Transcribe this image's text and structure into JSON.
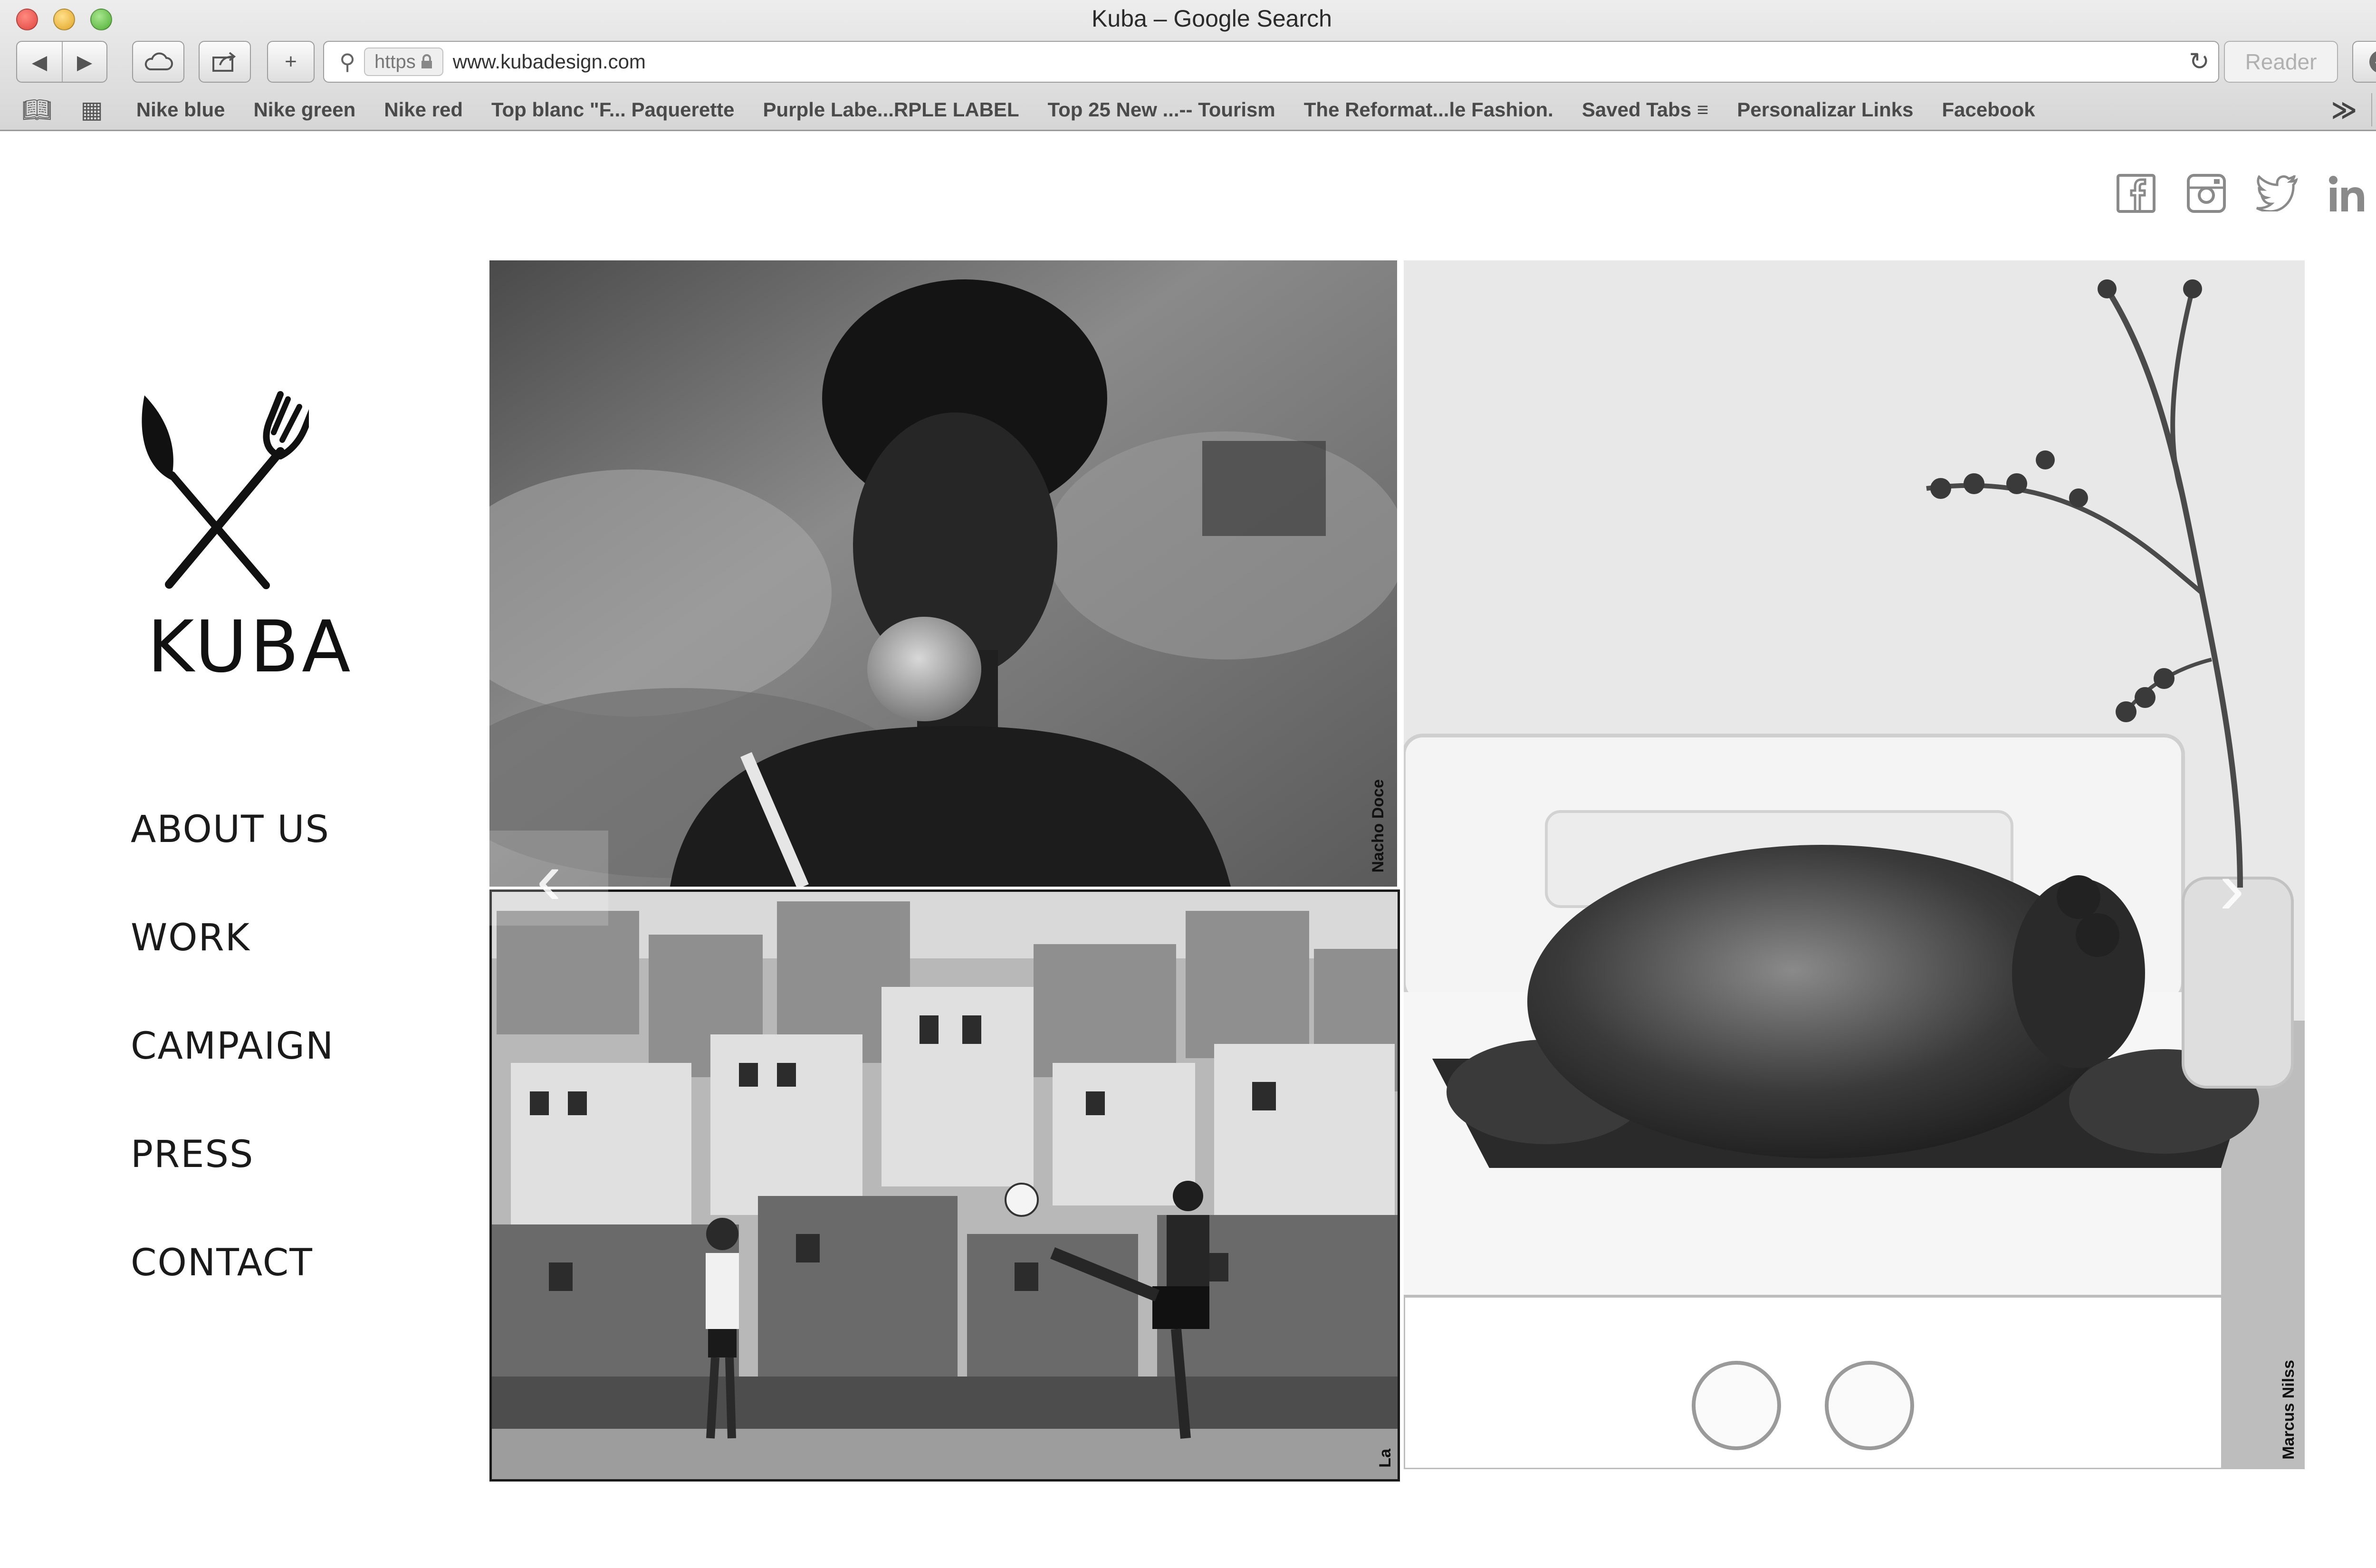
{
  "browser": {
    "window_title": "Kuba – Google Search",
    "url_scheme": "https",
    "url": "www.kubadesign.com",
    "reader_label": "Reader",
    "bookmarks": [
      "Nike blue",
      "Nike green",
      "Nike red",
      "Top blanc \"F... Paquerette",
      "Purple Labe...RPLE LABEL",
      "Top 25 New ...-- Tourism",
      "The Reformat...le Fashion.",
      "Saved Tabs ≡",
      "Personalizar Links",
      "Facebook"
    ],
    "bookmarks_more": "≫",
    "new_tab_label": "+"
  },
  "site": {
    "logo_text": "KUBA",
    "nav": [
      "ABOUT US",
      "WORK",
      "CAMPAIGN",
      "PRESS",
      "CONTACT"
    ],
    "social": [
      "facebook-icon",
      "instagram-icon",
      "twitter-icon",
      "linkedin-icon"
    ],
    "gallery": {
      "prev_arrow": "‹",
      "next_arrow": "›",
      "credits": {
        "girl": "Nacho Doce",
        "favela": "La",
        "turkey": "Marcus Nilss"
      }
    }
  },
  "colors": {
    "chrome_bg": "#dcdcdc",
    "page_bg": "#ffffff",
    "text": "#1a1a1a",
    "icon_grey": "#8a8a8a"
  }
}
